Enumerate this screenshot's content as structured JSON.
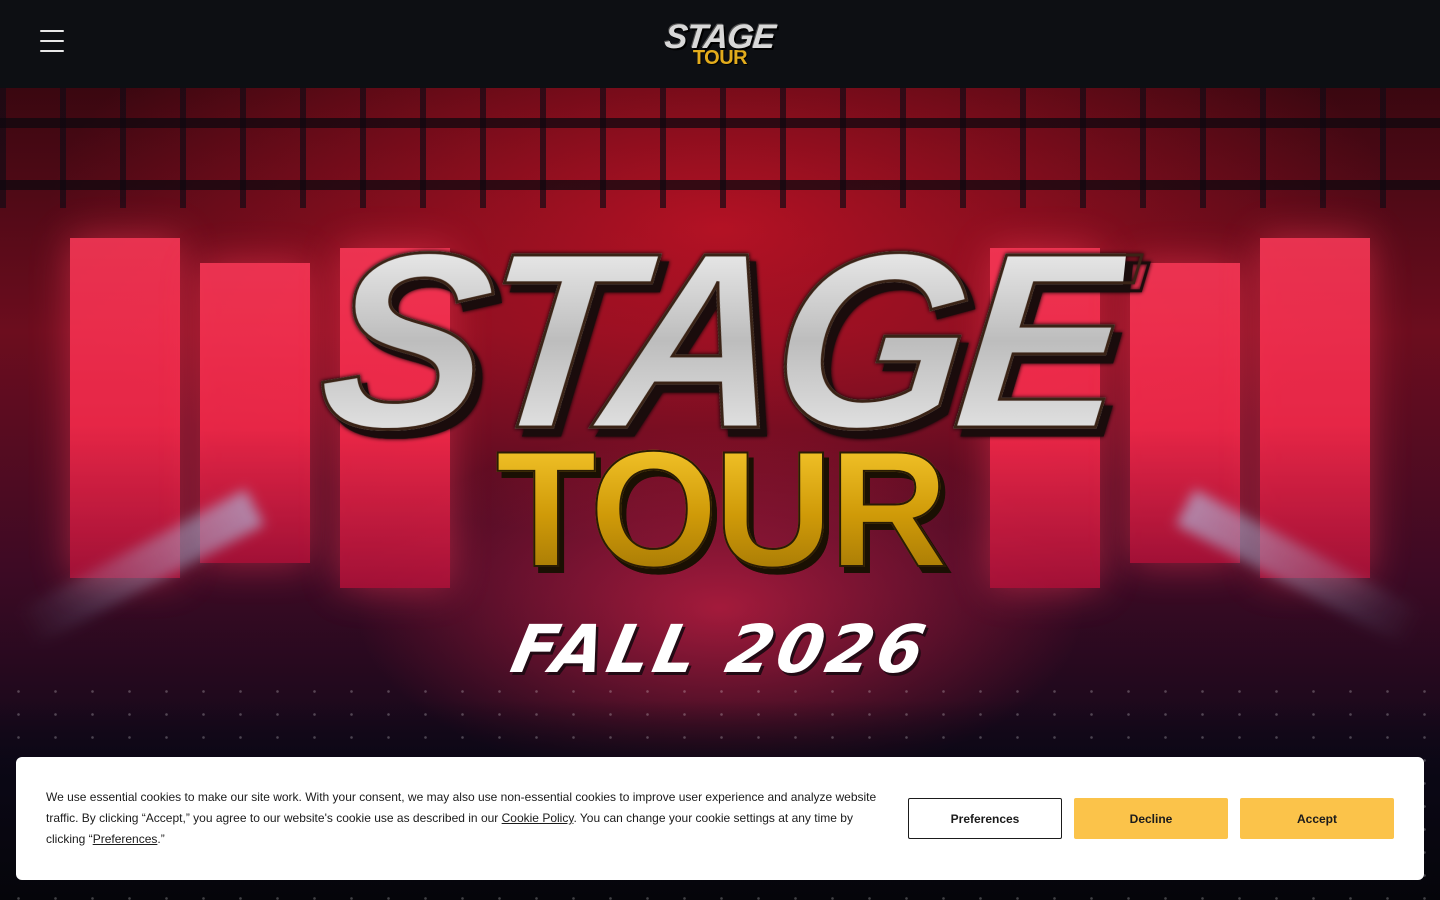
{
  "header": {
    "menu_icon": "hamburger-menu-icon",
    "logo_line1": "STAGE",
    "logo_line2": "TOUR"
  },
  "hero": {
    "title_line1": "STAGE",
    "title_line2": "TOUR",
    "subtitle": "FALL 2026"
  },
  "cookie_banner": {
    "text_part1": "We use essential cookies to make our site work. With your consent, we may also use non-essential cookies to improve user experience and analyze website traffic. By clicking “Accept,” you agree to our website's cookie use as described in our ",
    "cookie_policy_link": "Cookie Policy",
    "text_part2": ". You can change your cookie settings at any time by clicking “",
    "preferences_link": "Preferences",
    "text_part3": ".”",
    "buttons": {
      "preferences": "Preferences",
      "decline": "Decline",
      "accept": "Accept"
    }
  },
  "colors": {
    "header_bg": "#0d0f13",
    "accent_gold": "#e3ac1c",
    "button_yellow": "#fbc34a",
    "hero_red": "#ff2b4d"
  }
}
